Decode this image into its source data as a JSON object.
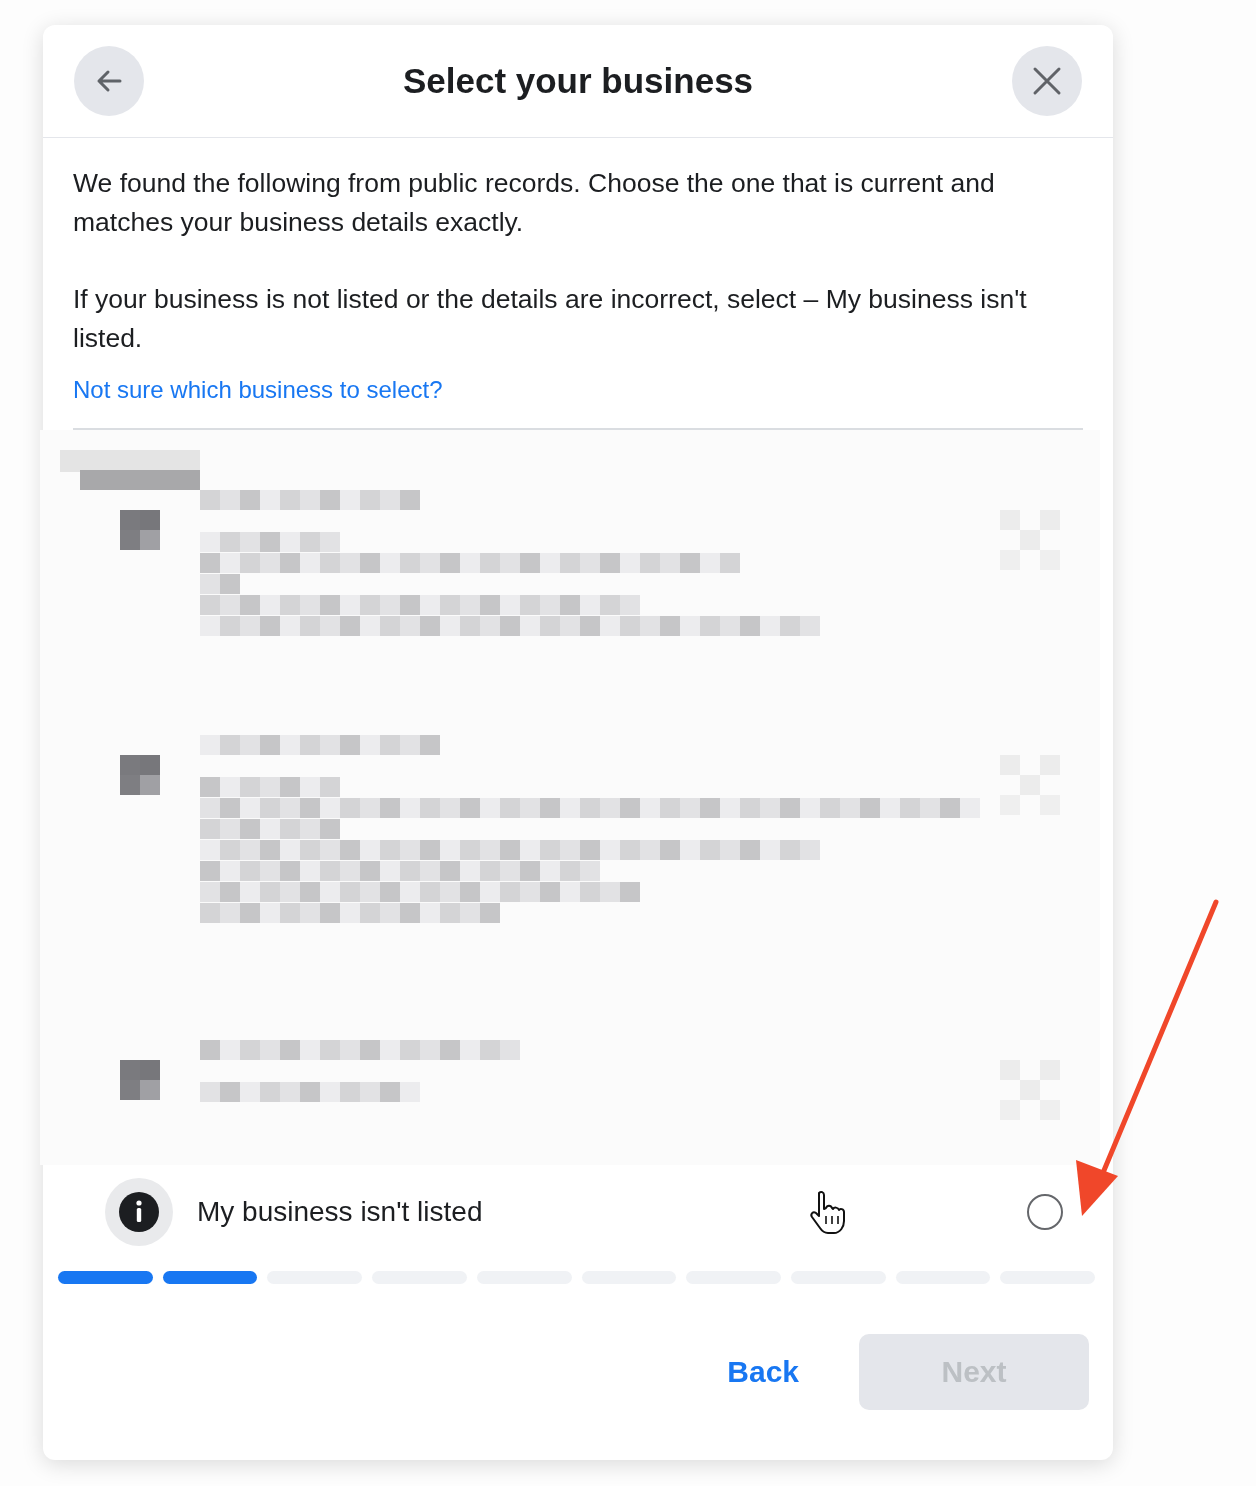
{
  "dialog": {
    "title": "Select your business",
    "paragraphs": [
      "We found the following from public records. Choose the one that is current and matches your business details exactly.",
      "If your business is not listed or the details are incorrect, select – My business isn't listed."
    ],
    "help_link": "Not sure which business to select?",
    "option": {
      "label": "My business isn't listed",
      "selected": false
    },
    "steps": [
      {
        "completed": true
      },
      {
        "completed": true
      },
      {
        "completed": false
      },
      {
        "completed": false
      },
      {
        "completed": false
      },
      {
        "completed": false
      },
      {
        "completed": false
      },
      {
        "completed": false
      },
      {
        "completed": false
      },
      {
        "completed": false
      }
    ],
    "buttons": [
      {
        "kind": "link",
        "label": "Back",
        "disabled": false
      },
      {
        "kind": "primary",
        "label": "Next",
        "disabled": true
      }
    ]
  }
}
